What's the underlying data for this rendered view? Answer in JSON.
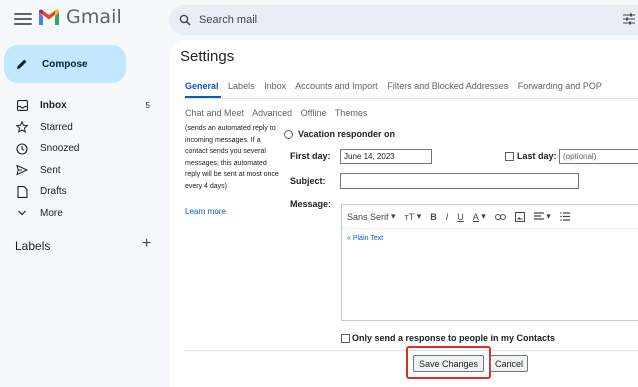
{
  "header": {
    "app_name": "Gmail",
    "search_placeholder": "Search mail"
  },
  "sidebar": {
    "compose_label": "Compose",
    "items": [
      {
        "label": "Inbox",
        "count": "5",
        "icon": "inbox-icon"
      },
      {
        "label": "Starred",
        "count": "",
        "icon": "star-icon"
      },
      {
        "label": "Snoozed",
        "count": "",
        "icon": "clock-icon"
      },
      {
        "label": "Sent",
        "count": "",
        "icon": "send-icon"
      },
      {
        "label": "Drafts",
        "count": "",
        "icon": "draft-icon"
      },
      {
        "label": "More",
        "count": "",
        "icon": "chevron-down-icon"
      }
    ],
    "labels_title": "Labels",
    "labels_add": "+"
  },
  "settings": {
    "title": "Settings",
    "tabs_row1": [
      "General",
      "Labels",
      "Inbox",
      "Accounts and Import",
      "Filters and Blocked Addresses",
      "Forwarding and POP"
    ],
    "tabs_row2": [
      "Chat and Meet",
      "Advanced",
      "Offline",
      "Themes"
    ],
    "description": "(sends an automated reply to incoming messages. If a contact sends you several messages, this automated reply will be sent at most once every 4 days)",
    "learn_more": "Learn more",
    "vacation_label": "Vacation responder on",
    "first_day_label": "First day:",
    "first_day_value": "June 14, 2023",
    "last_day_label": "Last day:",
    "last_day_placeholder": "(optional)",
    "subject_label": "Subject:",
    "message_label": "Message:",
    "toolbar": {
      "font": "Sans Serif",
      "size": "тТ",
      "bold": "B",
      "italic": "I",
      "underline": "U",
      "text_color": "A"
    },
    "plain_text": "« Plain Text",
    "only_contacts_label": "Only send a response to people in my Contacts",
    "save_label": "Save Changes",
    "cancel_label": "Cancel"
  },
  "colors": {
    "accent": "#0b57d0",
    "compose_bg": "#c2e7ff",
    "highlight": "#d93025"
  }
}
